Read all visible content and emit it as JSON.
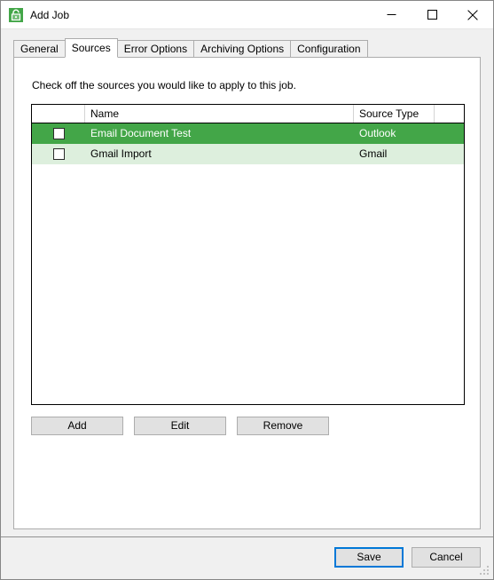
{
  "window": {
    "title": "Add Job",
    "icon": "app-lock-icon",
    "accent_green": "#43a648",
    "alt_row_green": "#ddefdd",
    "focus_blue": "#0078d7",
    "controls": {
      "minimize": "minimize-icon",
      "maximize": "maximize-icon",
      "close": "close-icon"
    }
  },
  "tabs": [
    {
      "label": "General",
      "selected": false
    },
    {
      "label": "Sources",
      "selected": true
    },
    {
      "label": "Error Options",
      "selected": false
    },
    {
      "label": "Archiving Options",
      "selected": false
    },
    {
      "label": "Configuration",
      "selected": false
    }
  ],
  "page": {
    "instruction": "Check off the sources you would like to apply to this job."
  },
  "grid": {
    "columns": [
      "",
      "Name",
      "Source Type",
      ""
    ],
    "rows": [
      {
        "checked": false,
        "name": "Email Document Test",
        "source_type": "Outlook",
        "selected": true
      },
      {
        "checked": false,
        "name": "Gmail Import",
        "source_type": "Gmail",
        "selected": false
      }
    ]
  },
  "actions": {
    "add": "Add",
    "edit": "Edit",
    "remove": "Remove"
  },
  "footer": {
    "save": "Save",
    "cancel": "Cancel"
  }
}
